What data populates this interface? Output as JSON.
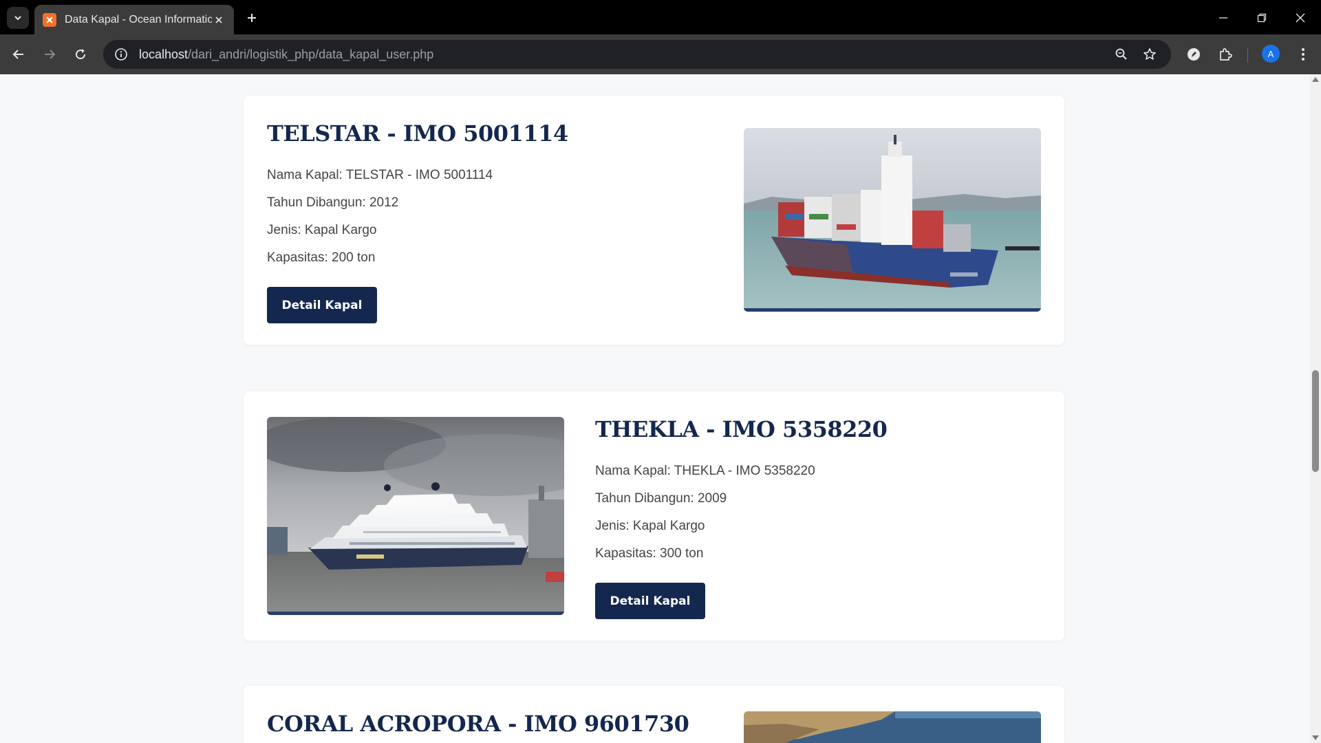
{
  "browser": {
    "tab_title": "Data Kapal - Ocean Information",
    "url_host": "localhost",
    "url_path": "/dari_andri/logistik_php/data_kapal_user.php",
    "profile_initial": "A"
  },
  "labels": {
    "name": "Nama Kapal:",
    "year": "Tahun Dibangun:",
    "type": "Jenis:",
    "capacity": "Kapasitas:",
    "detail_button": "Detail Kapal"
  },
  "ships": [
    {
      "title": "TELSTAR - IMO 5001114",
      "name": "TELSTAR - IMO 5001114",
      "year": "2012",
      "type": "Kapal Kargo",
      "capacity": "200 ton"
    },
    {
      "title": "THEKLA - IMO 5358220",
      "name": "THEKLA - IMO 5358220",
      "year": "2009",
      "type": "Kapal Kargo",
      "capacity": "300 ton"
    },
    {
      "title": "CORAL ACROPORA - IMO 9601730"
    }
  ],
  "colors": {
    "brand_navy": "#14274e",
    "page_bg": "#f7f8fa",
    "card_bg": "#ffffff"
  }
}
